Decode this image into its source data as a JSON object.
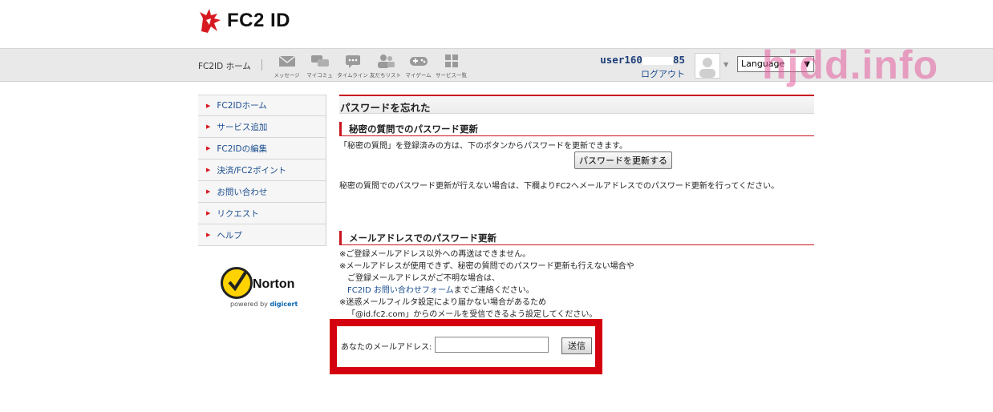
{
  "header": {
    "logo_text": "FC2 ID",
    "nav_home": "FC2ID ホーム",
    "nav_icons": [
      {
        "icon": "message-icon",
        "label": "メッセージ"
      },
      {
        "icon": "mycommu-icon",
        "label": "マイコミュ"
      },
      {
        "icon": "timeline-icon",
        "label": "タイムライン"
      },
      {
        "icon": "friends-icon",
        "label": "友だちリスト"
      },
      {
        "icon": "game-icon",
        "label": "マイゲーム"
      },
      {
        "icon": "services-icon",
        "label": "サービス一覧"
      }
    ],
    "user_prefix": "user160",
    "user_suffix": "85",
    "logout": "ログアウト",
    "language": "Language"
  },
  "watermark": "hjdd.info",
  "sidebar": {
    "items": [
      {
        "label": "FC2IDホーム"
      },
      {
        "label": "サービス追加"
      },
      {
        "label": "FC2IDの編集"
      },
      {
        "label": "決済/FC2ポイント"
      },
      {
        "label": "お問い合わせ"
      },
      {
        "label": "リクエスト"
      },
      {
        "label": "ヘルプ"
      }
    ],
    "norton_brand": "Norton",
    "norton_powered_prefix": "powered by ",
    "norton_powered_brand": "digicert"
  },
  "main": {
    "title": "パスワードを忘れた",
    "secret": {
      "heading": "秘密の質問でのパスワード更新",
      "text1": "「秘密の質問」を登録済みの方は、下のボタンからパスワードを更新できます。",
      "button": "パスワードを更新する",
      "text2": "秘密の質問でのパスワード更新が行えない場合は、下欄よりFC2へメールアドレスでのパスワード更新を行ってください。"
    },
    "email": {
      "heading": "メールアドレスでのパスワード更新",
      "note1": "※ご登録メールアドレス以外への再送はできません。",
      "note2": "※メールアドレスが使用できず、秘密の質問でのパスワード更新も行えない場合や",
      "note3": "ご登録メールアドレスがご不明な場合は、",
      "link": "FC2ID お問い合わせフォーム",
      "note4": "までご連絡ください。",
      "note5": "※迷惑メールフィルタ設定により届かない場合があるため",
      "note6": "「@id.fc2.com」からのメールを受信できるよう設定してください。",
      "field_label": "あなたのメールアドレス:",
      "field_value": "",
      "submit": "送信"
    }
  },
  "colors": {
    "accent": "#c9151e",
    "highlight_box": "#d4000f",
    "link": "#1a4d8f"
  }
}
